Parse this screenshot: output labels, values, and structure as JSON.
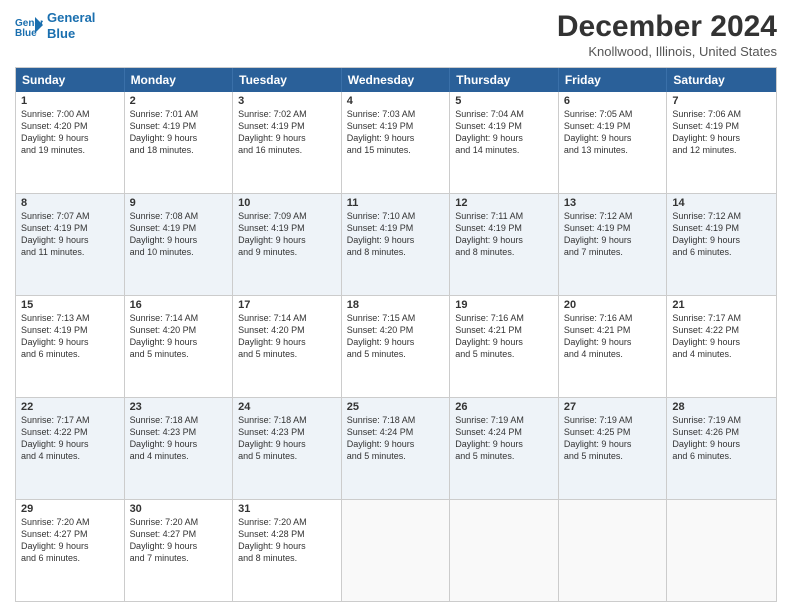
{
  "logo": {
    "line1": "General",
    "line2": "Blue"
  },
  "title": "December 2024",
  "location": "Knollwood, Illinois, United States",
  "days_of_week": [
    "Sunday",
    "Monday",
    "Tuesday",
    "Wednesday",
    "Thursday",
    "Friday",
    "Saturday"
  ],
  "weeks": [
    {
      "alt": false,
      "cells": [
        {
          "day": "1",
          "lines": [
            "Sunrise: 7:00 AM",
            "Sunset: 4:20 PM",
            "Daylight: 9 hours",
            "and 19 minutes."
          ]
        },
        {
          "day": "2",
          "lines": [
            "Sunrise: 7:01 AM",
            "Sunset: 4:19 PM",
            "Daylight: 9 hours",
            "and 18 minutes."
          ]
        },
        {
          "day": "3",
          "lines": [
            "Sunrise: 7:02 AM",
            "Sunset: 4:19 PM",
            "Daylight: 9 hours",
            "and 16 minutes."
          ]
        },
        {
          "day": "4",
          "lines": [
            "Sunrise: 7:03 AM",
            "Sunset: 4:19 PM",
            "Daylight: 9 hours",
            "and 15 minutes."
          ]
        },
        {
          "day": "5",
          "lines": [
            "Sunrise: 7:04 AM",
            "Sunset: 4:19 PM",
            "Daylight: 9 hours",
            "and 14 minutes."
          ]
        },
        {
          "day": "6",
          "lines": [
            "Sunrise: 7:05 AM",
            "Sunset: 4:19 PM",
            "Daylight: 9 hours",
            "and 13 minutes."
          ]
        },
        {
          "day": "7",
          "lines": [
            "Sunrise: 7:06 AM",
            "Sunset: 4:19 PM",
            "Daylight: 9 hours",
            "and 12 minutes."
          ]
        }
      ]
    },
    {
      "alt": true,
      "cells": [
        {
          "day": "8",
          "lines": [
            "Sunrise: 7:07 AM",
            "Sunset: 4:19 PM",
            "Daylight: 9 hours",
            "and 11 minutes."
          ]
        },
        {
          "day": "9",
          "lines": [
            "Sunrise: 7:08 AM",
            "Sunset: 4:19 PM",
            "Daylight: 9 hours",
            "and 10 minutes."
          ]
        },
        {
          "day": "10",
          "lines": [
            "Sunrise: 7:09 AM",
            "Sunset: 4:19 PM",
            "Daylight: 9 hours",
            "and 9 minutes."
          ]
        },
        {
          "day": "11",
          "lines": [
            "Sunrise: 7:10 AM",
            "Sunset: 4:19 PM",
            "Daylight: 9 hours",
            "and 8 minutes."
          ]
        },
        {
          "day": "12",
          "lines": [
            "Sunrise: 7:11 AM",
            "Sunset: 4:19 PM",
            "Daylight: 9 hours",
            "and 8 minutes."
          ]
        },
        {
          "day": "13",
          "lines": [
            "Sunrise: 7:12 AM",
            "Sunset: 4:19 PM",
            "Daylight: 9 hours",
            "and 7 minutes."
          ]
        },
        {
          "day": "14",
          "lines": [
            "Sunrise: 7:12 AM",
            "Sunset: 4:19 PM",
            "Daylight: 9 hours",
            "and 6 minutes."
          ]
        }
      ]
    },
    {
      "alt": false,
      "cells": [
        {
          "day": "15",
          "lines": [
            "Sunrise: 7:13 AM",
            "Sunset: 4:19 PM",
            "Daylight: 9 hours",
            "and 6 minutes."
          ]
        },
        {
          "day": "16",
          "lines": [
            "Sunrise: 7:14 AM",
            "Sunset: 4:20 PM",
            "Daylight: 9 hours",
            "and 5 minutes."
          ]
        },
        {
          "day": "17",
          "lines": [
            "Sunrise: 7:14 AM",
            "Sunset: 4:20 PM",
            "Daylight: 9 hours",
            "and 5 minutes."
          ]
        },
        {
          "day": "18",
          "lines": [
            "Sunrise: 7:15 AM",
            "Sunset: 4:20 PM",
            "Daylight: 9 hours",
            "and 5 minutes."
          ]
        },
        {
          "day": "19",
          "lines": [
            "Sunrise: 7:16 AM",
            "Sunset: 4:21 PM",
            "Daylight: 9 hours",
            "and 5 minutes."
          ]
        },
        {
          "day": "20",
          "lines": [
            "Sunrise: 7:16 AM",
            "Sunset: 4:21 PM",
            "Daylight: 9 hours",
            "and 4 minutes."
          ]
        },
        {
          "day": "21",
          "lines": [
            "Sunrise: 7:17 AM",
            "Sunset: 4:22 PM",
            "Daylight: 9 hours",
            "and 4 minutes."
          ]
        }
      ]
    },
    {
      "alt": true,
      "cells": [
        {
          "day": "22",
          "lines": [
            "Sunrise: 7:17 AM",
            "Sunset: 4:22 PM",
            "Daylight: 9 hours",
            "and 4 minutes."
          ]
        },
        {
          "day": "23",
          "lines": [
            "Sunrise: 7:18 AM",
            "Sunset: 4:23 PM",
            "Daylight: 9 hours",
            "and 4 minutes."
          ]
        },
        {
          "day": "24",
          "lines": [
            "Sunrise: 7:18 AM",
            "Sunset: 4:23 PM",
            "Daylight: 9 hours",
            "and 5 minutes."
          ]
        },
        {
          "day": "25",
          "lines": [
            "Sunrise: 7:18 AM",
            "Sunset: 4:24 PM",
            "Daylight: 9 hours",
            "and 5 minutes."
          ]
        },
        {
          "day": "26",
          "lines": [
            "Sunrise: 7:19 AM",
            "Sunset: 4:24 PM",
            "Daylight: 9 hours",
            "and 5 minutes."
          ]
        },
        {
          "day": "27",
          "lines": [
            "Sunrise: 7:19 AM",
            "Sunset: 4:25 PM",
            "Daylight: 9 hours",
            "and 5 minutes."
          ]
        },
        {
          "day": "28",
          "lines": [
            "Sunrise: 7:19 AM",
            "Sunset: 4:26 PM",
            "Daylight: 9 hours",
            "and 6 minutes."
          ]
        }
      ]
    },
    {
      "alt": false,
      "cells": [
        {
          "day": "29",
          "lines": [
            "Sunrise: 7:20 AM",
            "Sunset: 4:27 PM",
            "Daylight: 9 hours",
            "and 6 minutes."
          ]
        },
        {
          "day": "30",
          "lines": [
            "Sunrise: 7:20 AM",
            "Sunset: 4:27 PM",
            "Daylight: 9 hours",
            "and 7 minutes."
          ]
        },
        {
          "day": "31",
          "lines": [
            "Sunrise: 7:20 AM",
            "Sunset: 4:28 PM",
            "Daylight: 9 hours",
            "and 8 minutes."
          ]
        },
        {
          "day": "",
          "lines": []
        },
        {
          "day": "",
          "lines": []
        },
        {
          "day": "",
          "lines": []
        },
        {
          "day": "",
          "lines": []
        }
      ]
    }
  ]
}
